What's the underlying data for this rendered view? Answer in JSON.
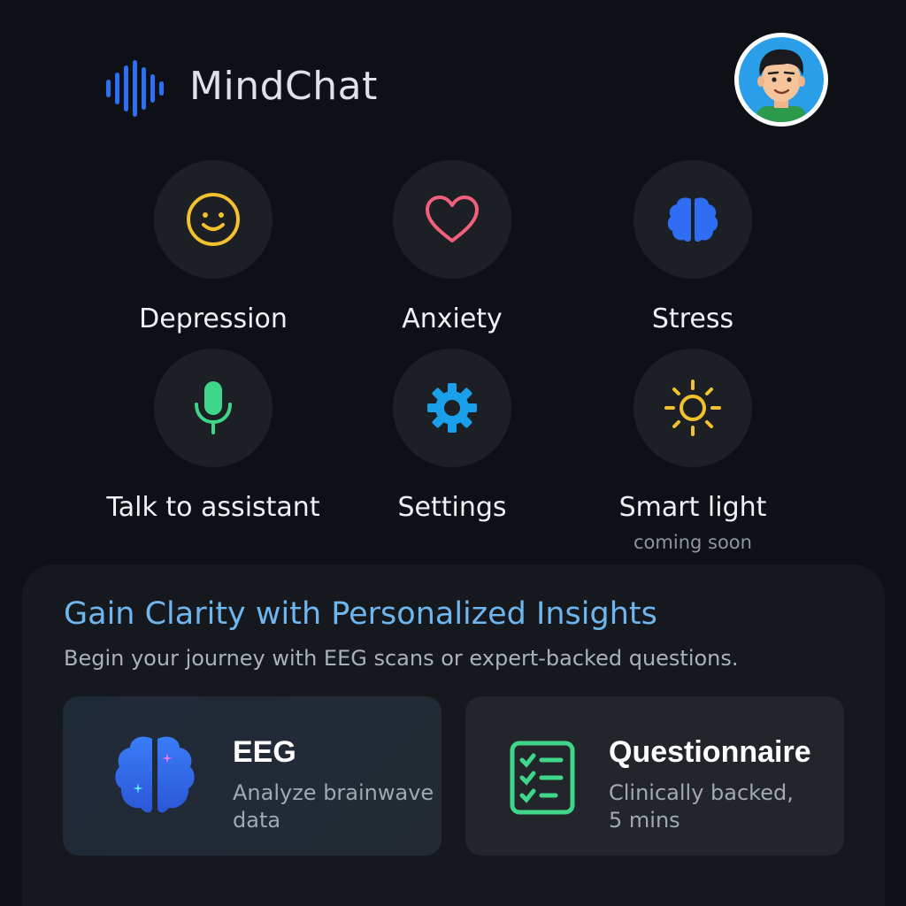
{
  "app": {
    "title": "MindChat"
  },
  "header": {
    "avatar_icon": "user-avatar"
  },
  "categories": [
    {
      "label": "Depression",
      "icon": "smile-icon",
      "color": "#f2c12e",
      "sub": ""
    },
    {
      "label": "Anxiety",
      "icon": "heart-icon",
      "color": "#f0607a",
      "sub": ""
    },
    {
      "label": "Stress",
      "icon": "brain-icon",
      "color": "#2f6df2",
      "sub": ""
    },
    {
      "label": "Talk to assistant",
      "icon": "microphone-icon",
      "color": "#3fd68a",
      "sub": ""
    },
    {
      "label": "Settings",
      "icon": "gear-icon",
      "color": "#1aa0ea",
      "sub": ""
    },
    {
      "label": "Smart light",
      "icon": "sun-icon",
      "color": "#f2c12e",
      "sub": "coming soon"
    }
  ],
  "insights": {
    "title": "Gain Clarity with Personalized Insights",
    "subtitle": "Begin your journey with EEG scans or expert-backed questions.",
    "cards": [
      {
        "title": "EEG",
        "description": "Analyze brainwave data",
        "icon": "brain-icon"
      },
      {
        "title": "Questionnaire",
        "description": "Clinically backed, 5 mins",
        "icon": "checklist-icon"
      }
    ]
  },
  "colors": {
    "background": "#0d1014",
    "accent": "#6fb6ee",
    "panel": "#15191e"
  }
}
